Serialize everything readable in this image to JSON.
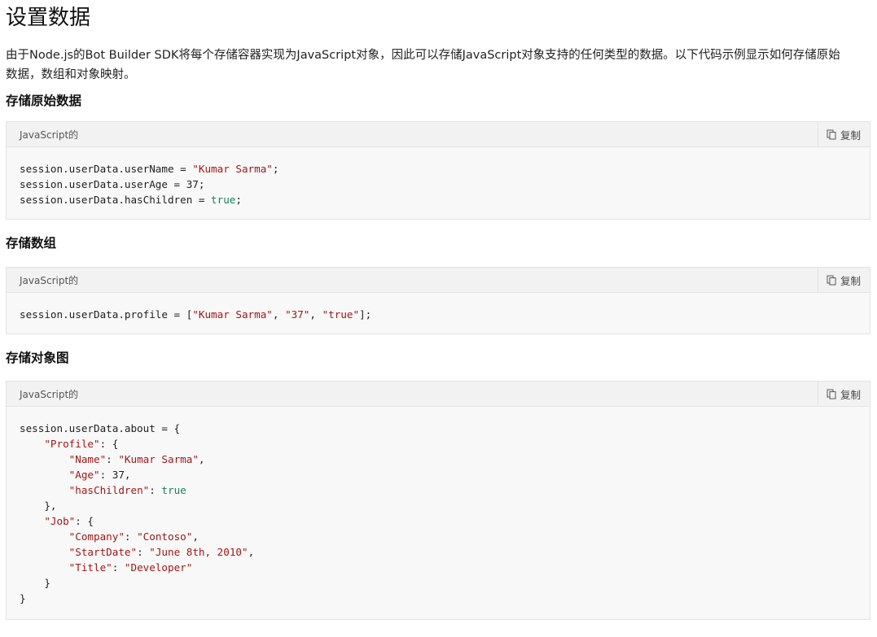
{
  "page": {
    "title": "设置数据",
    "intro": "由于Node.js的Bot Builder SDK将每个存储容器实现为JavaScript对象，因此可以存储JavaScript对象支持的任何类型的数据。以下代码示例显示如何存储原始数据，数组和对象映射。"
  },
  "sections": [
    {
      "heading": "存储原始数据",
      "language": "JavaScript的",
      "copy_label": "复制",
      "lines": [
        [
          {
            "t": "session.userData.userName = "
          },
          {
            "t": "\"Kumar Sarma\"",
            "c": "s"
          },
          {
            "t": ";"
          }
        ],
        [
          {
            "t": "session.userData.userAge = 37;"
          }
        ],
        [
          {
            "t": "session.userData.hasChildren = "
          },
          {
            "t": "true",
            "c": "k"
          },
          {
            "t": ";"
          }
        ]
      ]
    },
    {
      "heading": "存储数组",
      "language": "JavaScript的",
      "copy_label": "复制",
      "lines": [
        [
          {
            "t": "session.userData.profile = ["
          },
          {
            "t": "\"Kumar Sarma\"",
            "c": "s"
          },
          {
            "t": ", "
          },
          {
            "t": "\"37\"",
            "c": "s"
          },
          {
            "t": ", "
          },
          {
            "t": "\"true\"",
            "c": "s"
          },
          {
            "t": "];"
          }
        ]
      ]
    },
    {
      "heading": "存储对象图",
      "language": "JavaScript的",
      "copy_label": "复制",
      "lines": [
        [
          {
            "t": "session.userData.about = {"
          }
        ],
        [
          {
            "t": "    "
          },
          {
            "t": "\"Profile\"",
            "c": "s"
          },
          {
            "t": ": {"
          }
        ],
        [
          {
            "t": "        "
          },
          {
            "t": "\"Name\"",
            "c": "s"
          },
          {
            "t": ": "
          },
          {
            "t": "\"Kumar Sarma\"",
            "c": "s"
          },
          {
            "t": ","
          }
        ],
        [
          {
            "t": "        "
          },
          {
            "t": "\"Age\"",
            "c": "s"
          },
          {
            "t": ": 37,"
          }
        ],
        [
          {
            "t": "        "
          },
          {
            "t": "\"hasChildren\"",
            "c": "s"
          },
          {
            "t": ": "
          },
          {
            "t": "true",
            "c": "k"
          }
        ],
        [
          {
            "t": "    },"
          }
        ],
        [
          {
            "t": "    "
          },
          {
            "t": "\"Job\"",
            "c": "s"
          },
          {
            "t": ": {"
          }
        ],
        [
          {
            "t": "        "
          },
          {
            "t": "\"Company\"",
            "c": "s"
          },
          {
            "t": ": "
          },
          {
            "t": "\"Contoso\"",
            "c": "s"
          },
          {
            "t": ","
          }
        ],
        [
          {
            "t": "        "
          },
          {
            "t": "\"StartDate\"",
            "c": "s"
          },
          {
            "t": ": "
          },
          {
            "t": "\"June 8th, 2010\"",
            "c": "s"
          },
          {
            "t": ","
          }
        ],
        [
          {
            "t": "        "
          },
          {
            "t": "\"Title\"",
            "c": "s"
          },
          {
            "t": ": "
          },
          {
            "t": "\"Developer\"",
            "c": "s"
          }
        ],
        [
          {
            "t": "    }"
          }
        ],
        [
          {
            "t": "}"
          }
        ]
      ]
    }
  ],
  "icons": {
    "copy": "copy-icon"
  },
  "colors": {
    "string": "#a31515",
    "keyword": "#1a7f5a",
    "code_bg": "#f8f8f8",
    "header_bg": "#f2f2f2"
  }
}
